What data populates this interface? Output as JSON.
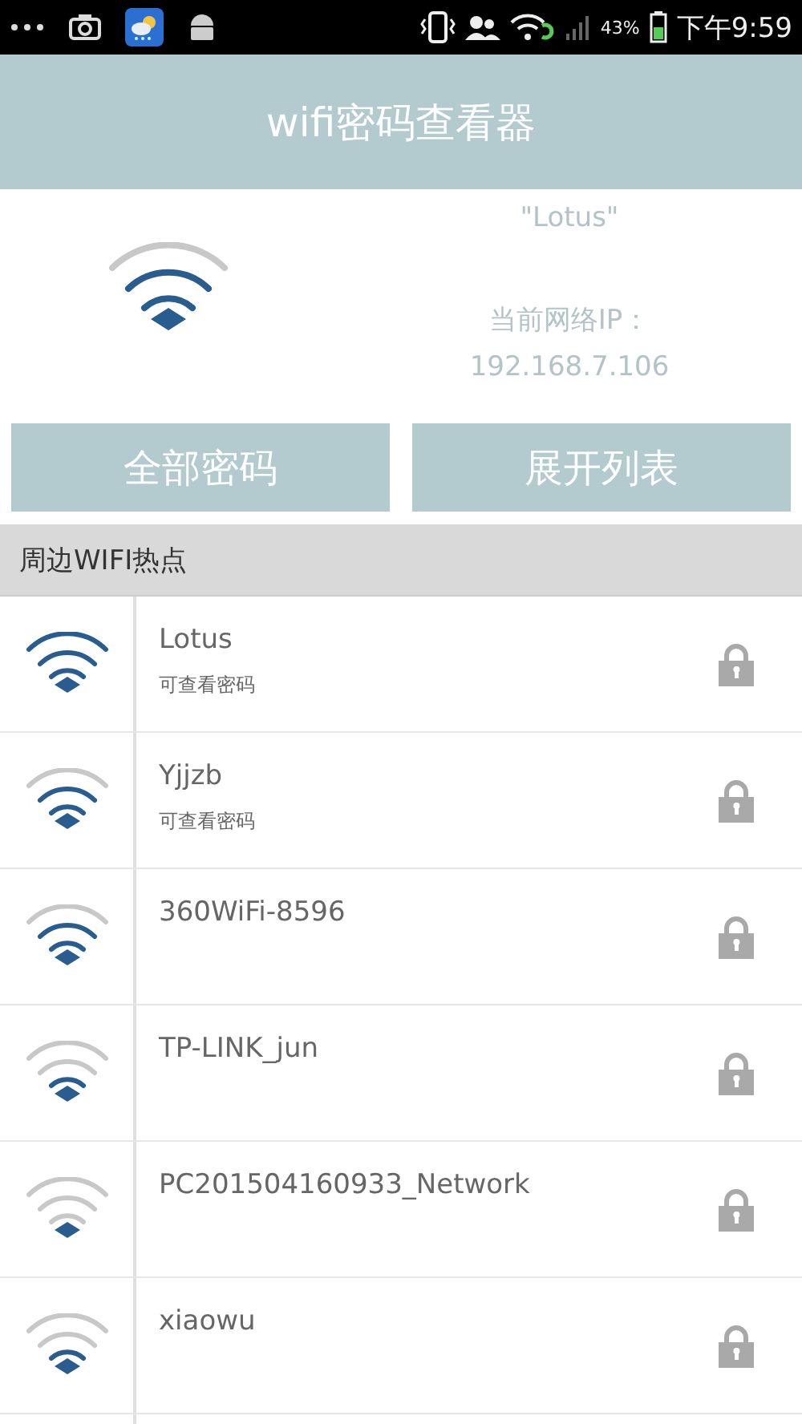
{
  "status_bar": {
    "battery": "43%",
    "time": "下午9:59"
  },
  "header": {
    "title": "wifi密码查看器"
  },
  "current": {
    "kind": "good",
    "ssid": "\"Lotus\"",
    "ip_label": "当前网络IP：",
    "ip": "192.168.7.106"
  },
  "buttons": [
    "全部密码",
    "展开列表"
  ],
  "section": {
    "title": "周边WIFI热点"
  },
  "networks": [
    {
      "name": "Lotus",
      "note": "可查看密码",
      "kind": "full",
      "locked": true
    },
    {
      "name": "Yjjzb",
      "note": "可查看密码",
      "kind": "good",
      "locked": true
    },
    {
      "name": "360WiFi-8596",
      "kind": "good",
      "locked": true
    },
    {
      "name": "TP-LINK_jun",
      "kind": "fair",
      "locked": true
    },
    {
      "name": "PC201504160933_Network",
      "kind": "weak",
      "locked": true
    },
    {
      "name": "xiaowu",
      "kind": "fair",
      "locked": true
    }
  ]
}
